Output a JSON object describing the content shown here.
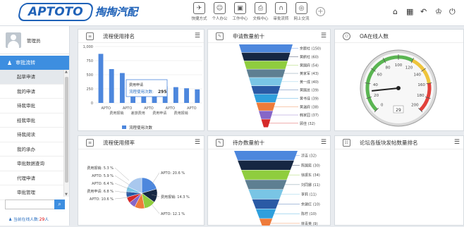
{
  "header": {
    "logo": "APTOTO",
    "logo_cn": "掏掏汽配",
    "tools": [
      {
        "label": "快捷方式",
        "icon": "send-icon",
        "glyph": "✈"
      },
      {
        "label": "个人办公",
        "icon": "person-icon",
        "glyph": "☺"
      },
      {
        "label": "工作中心",
        "icon": "briefcase-icon",
        "glyph": "▣"
      },
      {
        "label": "文档中心",
        "icon": "printer-icon",
        "glyph": "⎙"
      },
      {
        "label": "审批流转",
        "icon": "flow-icon",
        "glyph": "∩"
      },
      {
        "label": "网上交流",
        "icon": "chat-icon",
        "glyph": "◎"
      }
    ]
  },
  "sidebar": {
    "user_name": "管理员",
    "menu_title": "审批流转",
    "items": [
      "起草申请",
      "我的申请",
      "待我审批",
      "经我审批",
      "待我阅读",
      "我的承办",
      "审批数据查询",
      "代理申请",
      "审批管理"
    ],
    "online_prefix": "当前在线人数:",
    "online_count": "29",
    "online_suffix": "人"
  },
  "panels": {
    "p1": {
      "title": "流程使用排名"
    },
    "p2": {
      "title": "申请数量前十"
    },
    "p3": {
      "title": "OA在线人数"
    },
    "p4": {
      "title": "流程使用频率"
    },
    "p5": {
      "title": "待办数量前十"
    },
    "p6": {
      "title": "论坛各版块发帖数量排名"
    }
  },
  "bar_chart": {
    "type": "bar",
    "yticks": [
      "1,000",
      "750",
      "500",
      "250",
      "0"
    ],
    "ylim": [
      0,
      1000
    ],
    "values": [
      870,
      600,
      530,
      400,
      340,
      300,
      295,
      280,
      260,
      240
    ],
    "xtick_top": [
      "APTO",
      "APTO",
      "APTO",
      "APTO",
      "APTO"
    ],
    "xtick_bottom": [
      "费用报销",
      "差旅费用",
      "费用申请",
      "费用报销"
    ],
    "tooltip_title": "费用申请",
    "tooltip_label": "流程使用次数:",
    "tooltip_value": "295",
    "legend": "流程使用次数"
  },
  "funnel1": {
    "labels": [
      "余额社 (150)",
      "黄鹤社 (60)",
      "黄国府 (54)",
      "黄家军 (43)",
      "黄一成 (40)",
      "黄国总 (39)",
      "黄书佳 (39)",
      "黄温府 (38)",
      "韩家园 (37)",
      "顾佳 (32)"
    ],
    "colors": [
      "#4d87dd",
      "#162743",
      "#8fcd3e",
      "#5e7f92",
      "#79c5e5",
      "#2a5aa5",
      "#2f9fdc",
      "#ee7b3a",
      "#8666c8",
      "#d62929"
    ]
  },
  "gauge": {
    "value": "29",
    "ticks": [
      "0",
      "20",
      "40",
      "60",
      "80",
      "100",
      "120",
      "140",
      "160",
      "180",
      "200"
    ]
  },
  "pie": {
    "labels_left": [
      "费用报销: 5.3 %",
      "APTO: 5.9 %",
      "APTO: 6.4 %",
      "费用申请: 6.8 %",
      "APTO: 10.6 %"
    ],
    "labels_right": [
      "APTO: 20.6 %",
      "费用报销: 14.3 %",
      "APTO: 12.1 %"
    ],
    "slices": [
      20.6,
      14.3,
      12.1,
      10.6,
      6.8,
      6.4,
      5.9,
      5.3,
      18.0
    ],
    "colors": [
      "#4d87dd",
      "#162743",
      "#8fcd3e",
      "#ee7b3a",
      "#8666c8",
      "#d62929",
      "#2a5aa5",
      "#79c5e5",
      "#a9c8ee"
    ]
  },
  "funnel2": {
    "labels": [
      "凉吉 (32)",
      "陈国奕 (30)",
      "徐振东 (34)",
      "刘同娜 (11)",
      "李莉 (11)",
      "余建红 (10)",
      "陈柠 (10)",
      "林青英 (9)"
    ],
    "colors": [
      "#4d87dd",
      "#162743",
      "#8fcd3e",
      "#5e7f92",
      "#79c5e5",
      "#2a5aa5",
      "#2f9fdc",
      "#ee7b3a"
    ]
  }
}
